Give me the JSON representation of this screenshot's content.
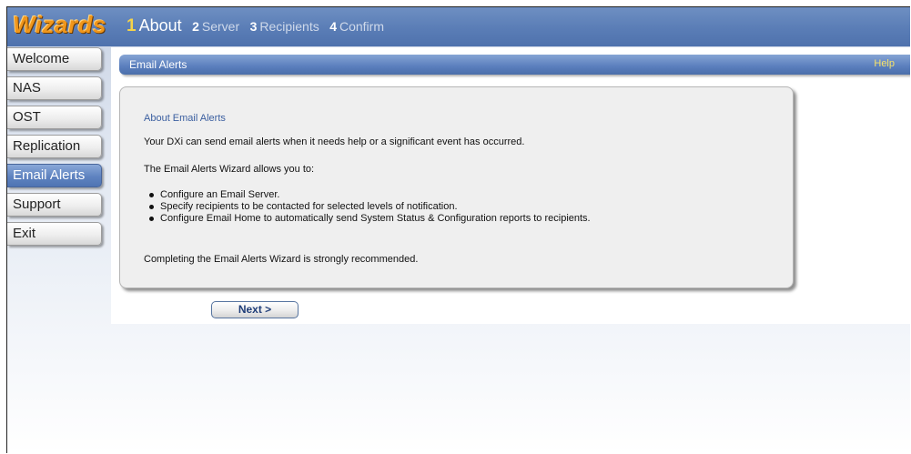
{
  "brand": {
    "logo_text": "Wizards"
  },
  "steps": [
    {
      "number": "1",
      "label": "About",
      "active": true
    },
    {
      "number": "2",
      "label": "Server",
      "active": false
    },
    {
      "number": "3",
      "label": "Recipients",
      "active": false
    },
    {
      "number": "4",
      "label": "Confirm",
      "active": false
    }
  ],
  "sidebar": {
    "items": [
      {
        "label": "Welcome"
      },
      {
        "label": "NAS"
      },
      {
        "label": "OST"
      },
      {
        "label": "Replication"
      },
      {
        "label": "Email Alerts",
        "active": true
      },
      {
        "label": "Support"
      },
      {
        "label": "Exit"
      }
    ]
  },
  "section": {
    "title": "Email Alerts",
    "help_label": "Help"
  },
  "panel": {
    "title": "About Email Alerts",
    "intro": "Your DXi can send email alerts when it needs help or a significant event has occurred.",
    "lead": "The Email Alerts Wizard allows you to:",
    "bullets": [
      "Configure an Email Server.",
      "Specify recipients to be contacted for selected levels of notification.",
      "Configure Email Home to automatically send System Status & Configuration reports to recipients."
    ],
    "footer": "Completing the Email Alerts Wizard is strongly recommended."
  },
  "actions": {
    "next_label": "Next >"
  },
  "colors": {
    "header_blue": "#5a7db6",
    "logo_orange": "#f0961b",
    "active_step_number": "#f5d34a",
    "help_link": "#f7e36a",
    "panel_title": "#3b5fa0"
  }
}
